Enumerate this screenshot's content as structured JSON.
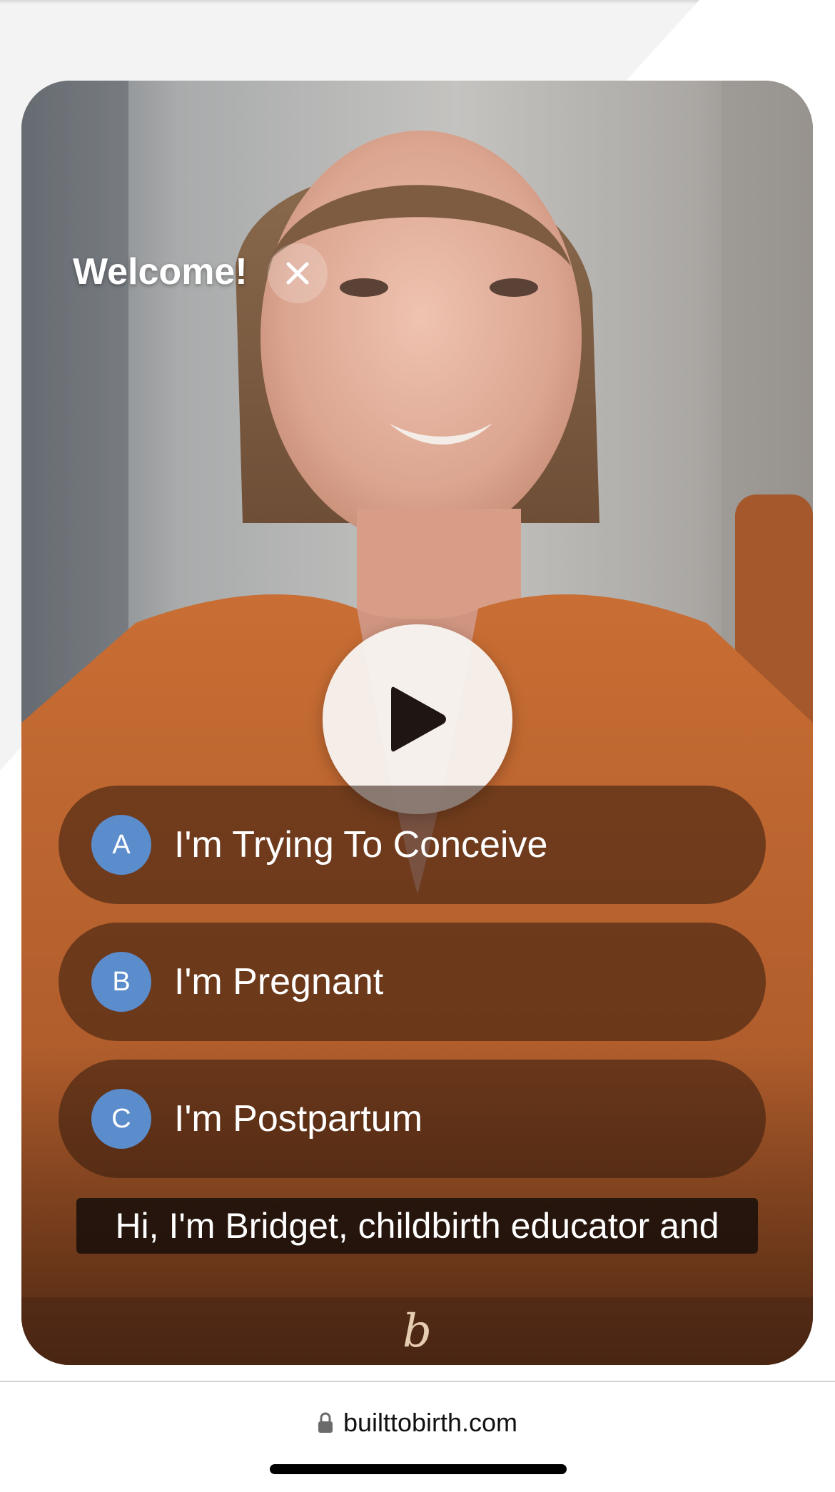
{
  "video": {
    "title": "Welcome!",
    "close_icon": "close-icon",
    "play_icon": "play-icon",
    "caption": "Hi, I'm Bridget, childbirth educator and",
    "logo_glyph": "b"
  },
  "options": [
    {
      "letter": "A",
      "label": "I'm Trying To Conceive"
    },
    {
      "letter": "B",
      "label": "I'm Pregnant"
    },
    {
      "letter": "C",
      "label": "I'm Postpartum"
    }
  ],
  "colors": {
    "badge": "#5b8ccc",
    "sweater": "#b8622e",
    "option_bg": "#32190c"
  },
  "browser": {
    "lock_icon": "lock-icon",
    "url": "builttobirth.com"
  }
}
